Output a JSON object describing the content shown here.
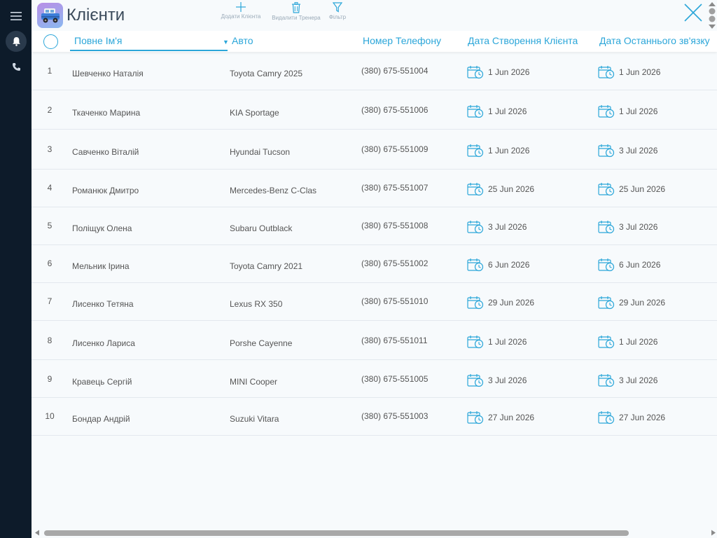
{
  "sidebar": {
    "icons": [
      "hamburger-menu-icon",
      "bell-icon",
      "phone-icon"
    ]
  },
  "header": {
    "title": "Клієнти",
    "toolbar": {
      "add_label": "Додати Клієнта",
      "delete_label": "Видалити Тренера",
      "filter_label": "Фільтр"
    }
  },
  "table": {
    "columns": {
      "name": "Повне Ім'я",
      "car": "Авто",
      "phone": "Номер Телефону",
      "created": "Дата Створення Клієнта",
      "last_contact": "Дата Останнього зв'язку"
    },
    "sorted_by": "name",
    "rows": [
      {
        "num": "1",
        "name": "Шевченко Наталія",
        "car": "Toyota Camry 2025",
        "phone": "(380) 675-551004",
        "created": "1 Jun 2026",
        "last": "1 Jun 2026"
      },
      {
        "num": "2",
        "name": "Ткаченко Марина",
        "car": "KIA Sportage",
        "phone": "(380) 675-551006",
        "created": "1 Jul 2026",
        "last": "1 Jul 2026"
      },
      {
        "num": "3",
        "name": "Савченко Віталій",
        "car": "Hyundai Tucson",
        "phone": "(380) 675-551009",
        "created": "1 Jun 2026",
        "last": "3 Jul 2026"
      },
      {
        "num": "4",
        "name": "Романюк Дмитро",
        "car": "Mercedes-Benz C-Clas",
        "phone": "(380) 675-551007",
        "created": "25 Jun 2026",
        "last": "25 Jun 2026"
      },
      {
        "num": "5",
        "name": "Поліщук Олена",
        "car": "Subaru Outblack",
        "phone": "(380) 675-551008",
        "created": "3 Jul 2026",
        "last": "3 Jul 2026"
      },
      {
        "num": "6",
        "name": "Мельник Ірина",
        "car": "Toyota Camry 2021",
        "phone": "(380) 675-551002",
        "created": "6 Jun 2026",
        "last": "6 Jun 2026"
      },
      {
        "num": "7",
        "name": "Лисенко Тетяна",
        "car": "Lexus RX 350",
        "phone": "(380) 675-551010",
        "created": "29 Jun 2026",
        "last": "29 Jun 2026"
      },
      {
        "num": "8",
        "name": "Лисенко Лариса",
        "car": "Porshe Cayenne",
        "phone": "(380) 675-551011",
        "created": "1 Jul 2026",
        "last": "1 Jul 2026"
      },
      {
        "num": "9",
        "name": "Кравець Сергій",
        "car": "MINI Cooper",
        "phone": "(380) 675-551005",
        "created": "3 Jul 2026",
        "last": "3 Jul 2026"
      },
      {
        "num": "10",
        "name": "Бондар Андрій",
        "car": "Suzuki Vitara",
        "phone": "(380) 675-551003",
        "created": "27 Jun 2026",
        "last": "27 Jun 2026"
      }
    ]
  },
  "colors": {
    "accent": "#2ba6d9",
    "sidebar": "#0d1b2a",
    "background": "#f7fafc"
  }
}
